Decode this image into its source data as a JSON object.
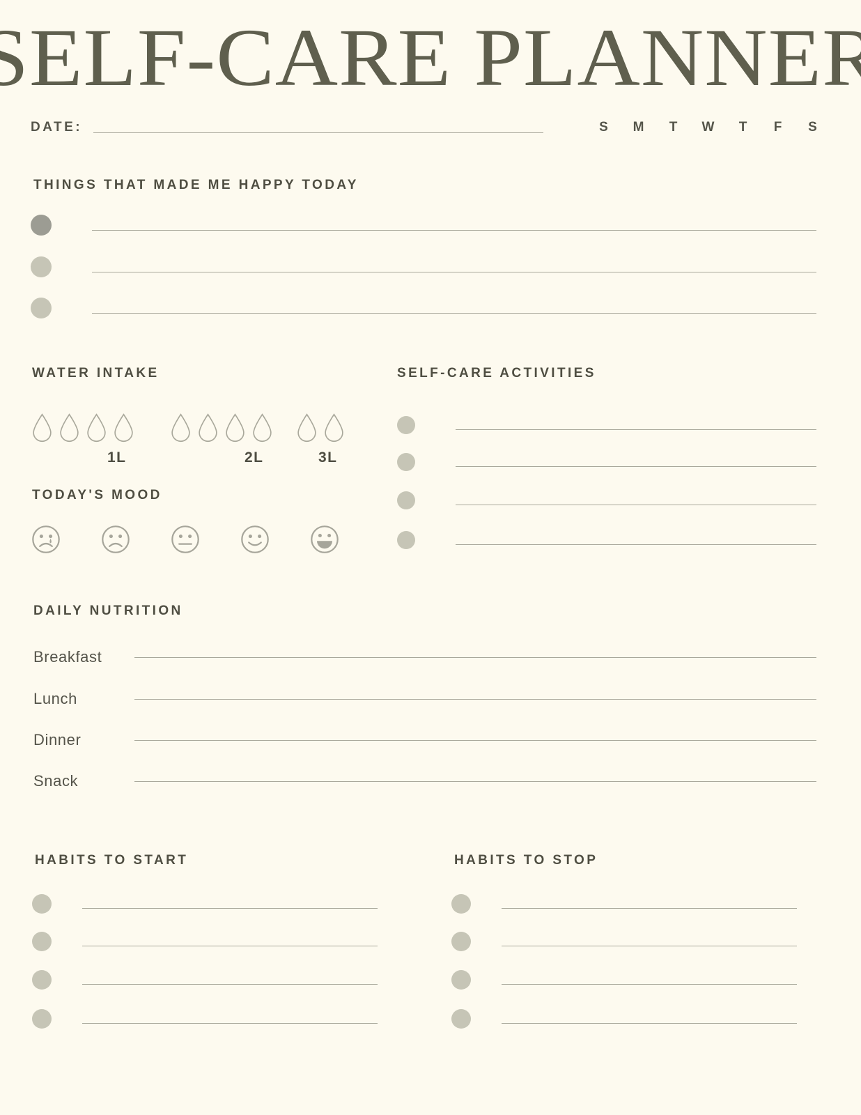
{
  "page": {
    "title": "SELF-CARE PLANNER",
    "background_color": "#fdfaef",
    "ink_color": "#4f4e42",
    "rule_color": "#a9a89b",
    "bullet_color": "#c6c5b6",
    "bullet_active_color": "#9c9c93"
  },
  "date": {
    "label": "DATE:",
    "value": "",
    "placeholder": "",
    "days": [
      "S",
      "M",
      "T",
      "W",
      "T",
      "F",
      "S"
    ]
  },
  "happy": {
    "heading": "THINGS THAT MADE ME HAPPY TODAY",
    "items": [
      {
        "value": ""
      },
      {
        "value": ""
      },
      {
        "value": ""
      }
    ]
  },
  "water": {
    "heading": "WATER INTAKE",
    "groups": [
      {
        "drops": 4,
        "label": "1L"
      },
      {
        "drops": 4,
        "label": "2L"
      },
      {
        "drops": 2,
        "label": "3L"
      }
    ]
  },
  "mood": {
    "heading": "TODAY'S MOOD",
    "faces": [
      {
        "name": "crying-face-icon",
        "label": "very sad"
      },
      {
        "name": "sad-face-icon",
        "label": "sad"
      },
      {
        "name": "neutral-face-icon",
        "label": "neutral"
      },
      {
        "name": "smiling-face-icon",
        "label": "happy"
      },
      {
        "name": "grinning-face-icon",
        "label": "very happy"
      }
    ]
  },
  "activities": {
    "heading": "SELF-CARE ACTIVITIES",
    "items": [
      {
        "value": ""
      },
      {
        "value": ""
      },
      {
        "value": ""
      },
      {
        "value": ""
      }
    ]
  },
  "nutrition": {
    "heading": "DAILY NUTRITION",
    "rows": [
      {
        "label": "Breakfast",
        "value": ""
      },
      {
        "label": "Lunch",
        "value": ""
      },
      {
        "label": "Dinner",
        "value": ""
      },
      {
        "label": "Snack",
        "value": ""
      }
    ]
  },
  "habits_start": {
    "heading": "HABITS TO START",
    "items": [
      {
        "value": ""
      },
      {
        "value": ""
      },
      {
        "value": ""
      },
      {
        "value": ""
      }
    ]
  },
  "habits_stop": {
    "heading": "HABITS TO STOP",
    "items": [
      {
        "value": ""
      },
      {
        "value": ""
      },
      {
        "value": ""
      },
      {
        "value": ""
      }
    ]
  }
}
